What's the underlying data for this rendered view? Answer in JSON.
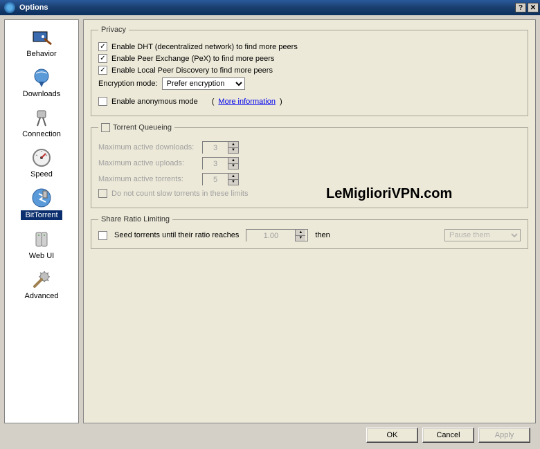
{
  "window": {
    "title": "Options"
  },
  "sidebar": {
    "items": [
      {
        "label": "Behavior"
      },
      {
        "label": "Downloads"
      },
      {
        "label": "Connection"
      },
      {
        "label": "Speed"
      },
      {
        "label": "BitTorrent"
      },
      {
        "label": "Web UI"
      },
      {
        "label": "Advanced"
      }
    ],
    "selected_index": 4
  },
  "privacy": {
    "legend": "Privacy",
    "enable_dht": {
      "checked": true,
      "label": "Enable DHT (decentralized network) to find more peers"
    },
    "enable_pex": {
      "checked": true,
      "label": "Enable Peer Exchange (PeX) to find more peers"
    },
    "enable_lpd": {
      "checked": true,
      "label": "Enable Local Peer Discovery to find more peers"
    },
    "encryption_label": "Encryption mode:",
    "encryption_value": "Prefer encryption",
    "enable_anon": {
      "checked": false,
      "label": "Enable anonymous mode"
    },
    "more_info": "More information"
  },
  "queueing": {
    "legend": "Torrent Queueing",
    "enabled": false,
    "max_downloads": {
      "label": "Maximum active downloads:",
      "value": "3"
    },
    "max_uploads": {
      "label": "Maximum active uploads:",
      "value": "3"
    },
    "max_torrents": {
      "label": "Maximum active torrents:",
      "value": "5"
    },
    "no_count_slow": {
      "checked": false,
      "label": "Do not count slow torrents in these limits"
    }
  },
  "share_ratio": {
    "legend": "Share Ratio Limiting",
    "seed_until": {
      "checked": false,
      "label": "Seed torrents until their ratio reaches"
    },
    "ratio_value": "1.00",
    "then_label": "then",
    "action": "Pause them"
  },
  "buttons": {
    "ok": "OK",
    "cancel": "Cancel",
    "apply": "Apply"
  },
  "watermark": "LeMiglioriVPN.com"
}
